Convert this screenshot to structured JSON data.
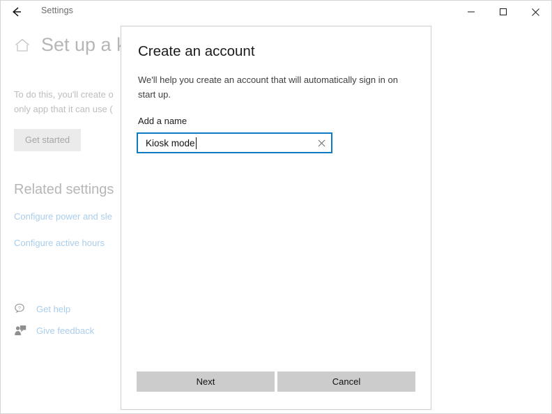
{
  "window": {
    "title": "Settings",
    "back_icon": "back-arrow-icon",
    "controls": {
      "minimize": "minimize-icon",
      "maximize": "maximize-icon",
      "close": "close-icon"
    }
  },
  "page": {
    "home_icon": "home-icon",
    "title": "Set up a k",
    "body_line1": "To do this, you'll create o",
    "body_line2": "only app that it can use (",
    "get_started_label": "Get started",
    "related_heading": "Related settings",
    "links": [
      {
        "label": "Configure power and sle",
        "icon": "link-icon"
      },
      {
        "label": "Configure active hours",
        "icon": "link-icon"
      }
    ],
    "help": [
      {
        "label": "Get help",
        "icon": "question-bubble-icon"
      },
      {
        "label": "Give feedback",
        "icon": "person-feedback-icon"
      }
    ]
  },
  "dialog": {
    "title": "Create an account",
    "description": "We'll help you create an account that will automatically sign in on start up.",
    "field_label": "Add a name",
    "input": {
      "value": "Kiosk mode",
      "placeholder": "",
      "clear_icon": "clear-x-icon",
      "focused": true
    },
    "primary_button": "Next",
    "secondary_button": "Cancel"
  },
  "colors": {
    "accent": "#0e7ac4",
    "button_face": "#cccccc",
    "disabled_button_face": "#ebebeb",
    "link_dim": "#aacdeb",
    "dim_text": "#b6b6b6"
  }
}
